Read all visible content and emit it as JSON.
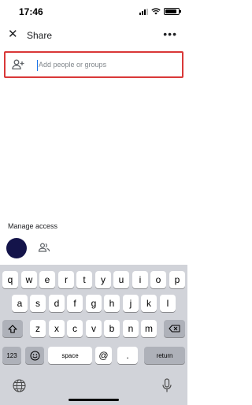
{
  "status_bar": {
    "time": "17:46"
  },
  "header": {
    "title": "Share"
  },
  "add_people": {
    "placeholder": "Add people or groups"
  },
  "manage_access": {
    "label": "Manage access"
  },
  "keyboard": {
    "row1": [
      "q",
      "w",
      "e",
      "r",
      "t",
      "y",
      "u",
      "i",
      "o",
      "p"
    ],
    "row2": [
      "a",
      "s",
      "d",
      "f",
      "g",
      "h",
      "j",
      "k",
      "l"
    ],
    "row3": [
      "z",
      "x",
      "c",
      "v",
      "b",
      "n",
      "m"
    ],
    "numbers_label": "123",
    "space_label": "space",
    "at_label": "@",
    "dot_label": ".",
    "return_label": "return"
  },
  "colors": {
    "highlight_border": "#d93838",
    "avatar": "#14144a",
    "keyboard_bg": "#d1d3d9"
  }
}
